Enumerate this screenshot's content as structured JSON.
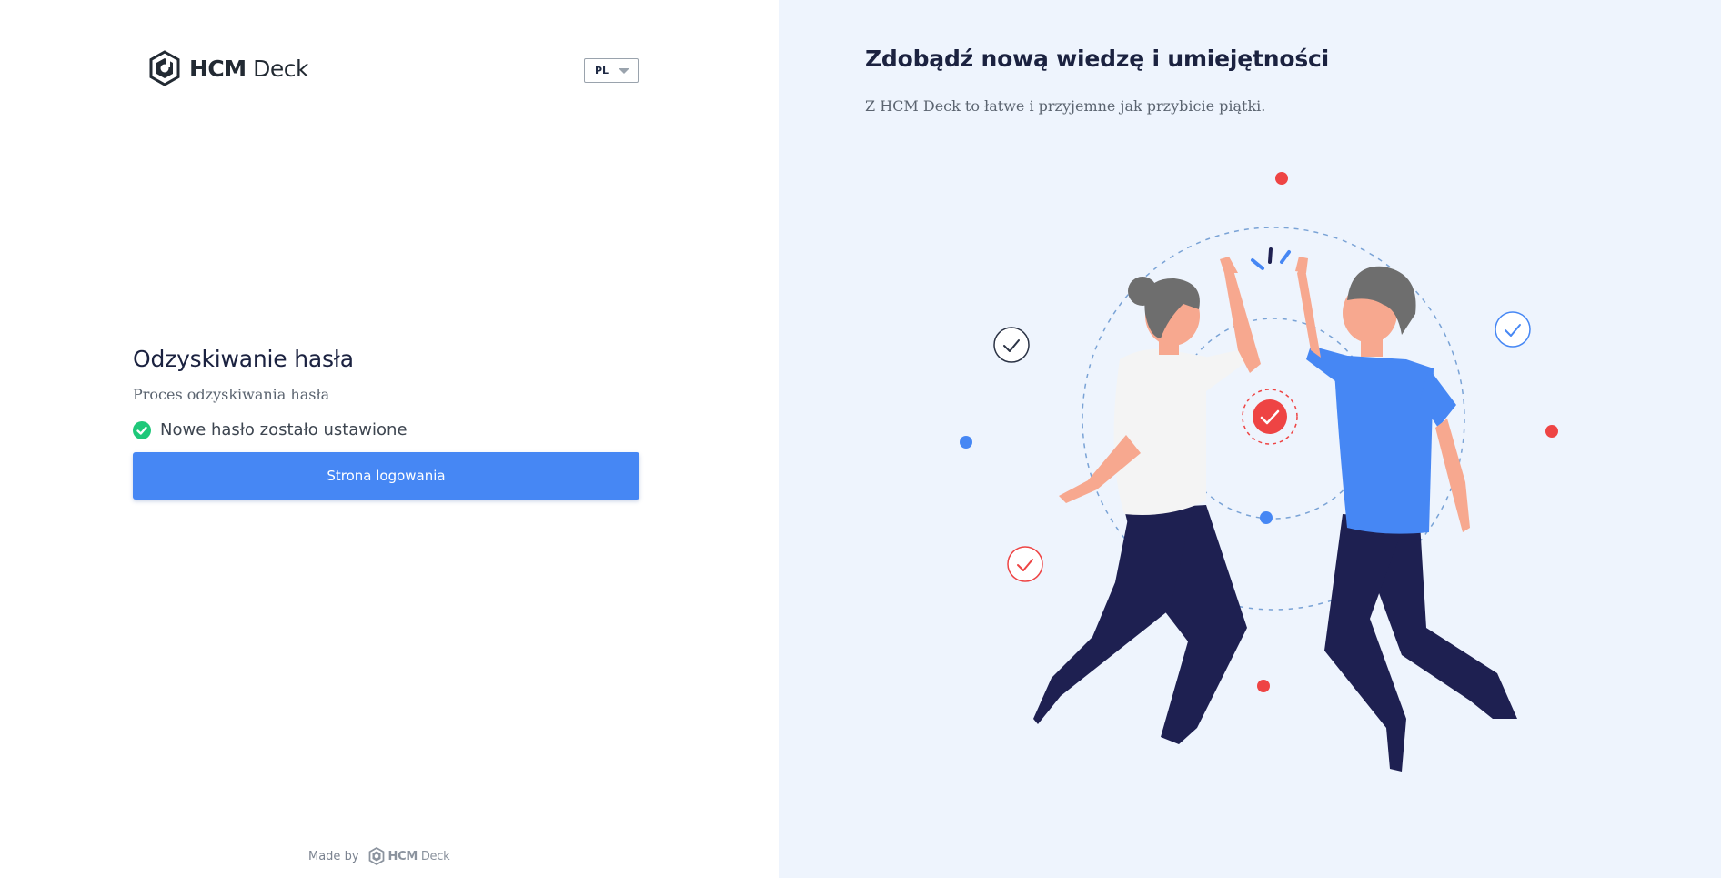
{
  "brand": {
    "bold": "HCM",
    "light": "Deck"
  },
  "language": {
    "selected": "PL"
  },
  "form": {
    "title": "Odzyskiwanie hasła",
    "subtitle": "Proces odzyskiwania hasła",
    "success_message": "Nowe hasło zostało ustawione",
    "login_button": "Strona logowania"
  },
  "footer": {
    "made_by": "Made by",
    "brand_bold": "HCM",
    "brand_light": "Deck"
  },
  "promo": {
    "title": "Zdobądź nową wiedzę i umiejętności",
    "subtitle": "Z HCM Deck to łatwe i przyjemne jak przybicie piątki."
  },
  "colors": {
    "accent": "#4687f4",
    "success": "#1fc87a",
    "danger": "#ee4444",
    "navy": "#1e2051",
    "right_bg": "#eef4fd"
  }
}
